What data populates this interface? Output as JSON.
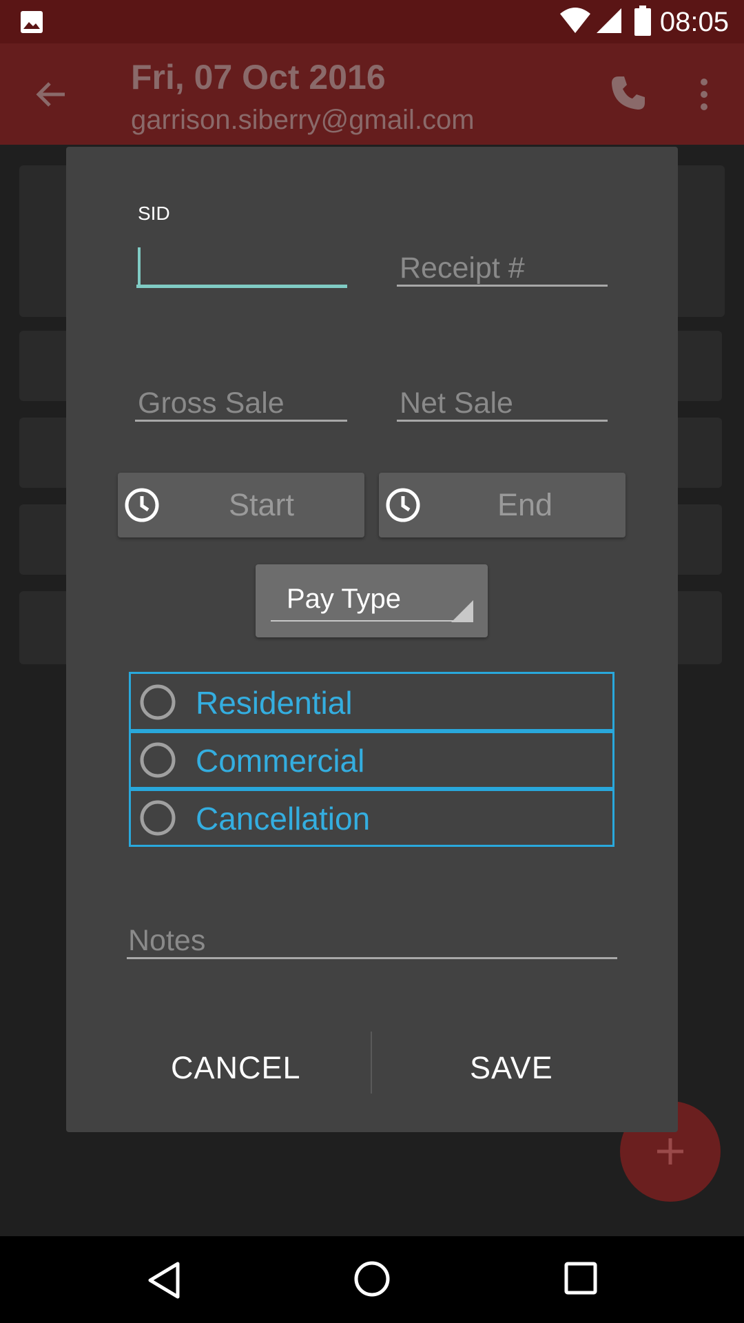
{
  "status_bar": {
    "time": "08:05"
  },
  "app_bar": {
    "title": "Fri, 07 Oct 2016",
    "subtitle": "garrison.siberry@gmail.com"
  },
  "dialog": {
    "sid_label": "SID",
    "sid_value": "",
    "receipt_placeholder": "Receipt #",
    "gross_sale_placeholder": "Gross Sale",
    "net_sale_placeholder": "Net Sale",
    "start_label": "Start",
    "end_label": "End",
    "pay_type_label": "Pay Type",
    "radio_options": [
      "Residential",
      "Commercial",
      "Cancellation"
    ],
    "notes_placeholder": "Notes",
    "cancel_label": "CANCEL",
    "save_label": "SAVE"
  },
  "fab": {
    "icon": "plus-icon"
  },
  "colors": {
    "accent_blue": "#29a8dc",
    "cursor_teal": "#80cbc4",
    "primary_red_dimmed": "#651d1d"
  }
}
